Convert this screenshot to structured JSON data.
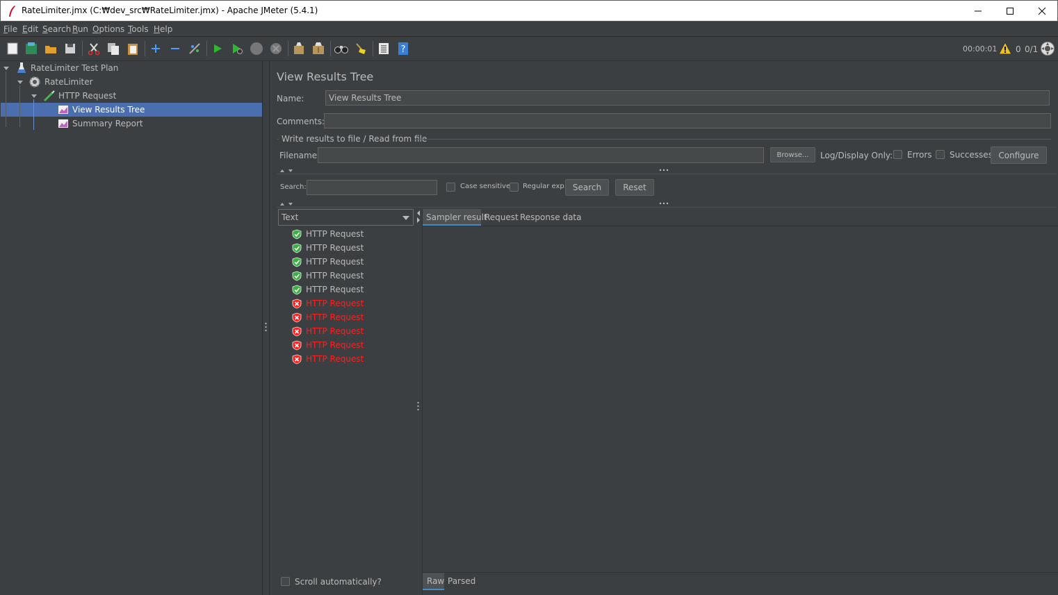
{
  "window": {
    "title": "RateLimiter.jmx (C:₩dev_src₩RateLimiter.jmx) - Apache JMeter (5.4.1)",
    "min_label": "—",
    "max_label": "☐",
    "close_label": "✕"
  },
  "menu": {
    "file": "File",
    "edit": "Edit",
    "search": "Search",
    "run": "Run",
    "options": "Options",
    "tools": "Tools",
    "help": "Help"
  },
  "toolbar": {
    "elapsed": "00:00:01",
    "warnings": "0",
    "threads": "0/1"
  },
  "tree": {
    "plan": "RateLimiter Test Plan",
    "thread_group": "RateLimiter",
    "sampler": "HTTP Request",
    "listener_selected": "View Results Tree",
    "listener_2": "Summary Report"
  },
  "panel": {
    "heading": "View Results Tree",
    "name_label": "Name:",
    "name_value": "View Results Tree",
    "comments_label": "Comments:",
    "comments_value": "",
    "file_section": "Write results to file / Read from file",
    "filename_label": "Filename",
    "filename_value": "",
    "browse": "Browse...",
    "log_display": "Log/Display Only:",
    "errors": "Errors",
    "successes": "Successes",
    "configure": "Configure",
    "search_label": "Search:",
    "search_value": "",
    "case_sensitive": "Case sensitive",
    "regular_exp": "Regular exp.",
    "search_button": "Search",
    "reset_button": "Reset",
    "renderer": "Text",
    "scroll_auto": "Scroll automatically?"
  },
  "results": [
    {
      "label": "HTTP Request",
      "status": "success"
    },
    {
      "label": "HTTP Request",
      "status": "success"
    },
    {
      "label": "HTTP Request",
      "status": "success"
    },
    {
      "label": "HTTP Request",
      "status": "success"
    },
    {
      "label": "HTTP Request",
      "status": "success"
    },
    {
      "label": "HTTP Request",
      "status": "failure"
    },
    {
      "label": "HTTP Request",
      "status": "failure"
    },
    {
      "label": "HTTP Request",
      "status": "failure"
    },
    {
      "label": "HTTP Request",
      "status": "failure"
    },
    {
      "label": "HTTP Request",
      "status": "failure"
    }
  ],
  "tabs": {
    "sampler_result": "Sampler result",
    "request": "Request",
    "response_data": "Response data",
    "raw": "Raw",
    "parsed": "Parsed"
  },
  "colors": {
    "background": "#3c3f41",
    "selection": "#4b6eaf",
    "success_green": "#3cb043",
    "failure_red": "#ff1f1f",
    "text": "#bbbbbb"
  }
}
